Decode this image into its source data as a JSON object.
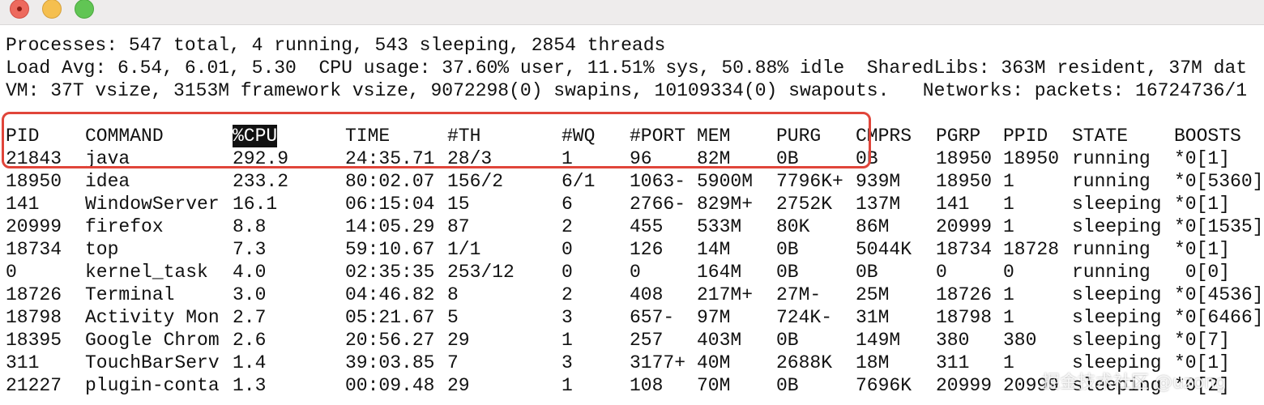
{
  "window": {
    "buttons": {
      "close": "close-button",
      "minimize": "minimize-button",
      "zoom": "zoom-button"
    }
  },
  "summary": [
    "Processes: 547 total, 4 running, 543 sleeping, 2854 threads",
    "Load Avg: 6.54, 6.01, 5.30  CPU usage: 37.60% user, 11.51% sys, 50.88% idle  SharedLibs: 363M resident, 37M dat",
    "VM: 37T vsize, 3153M framework vsize, 9072298(0) swapins, 10109334(0) swapouts.   Networks: packets: 16724736/1"
  ],
  "table": {
    "columns": [
      "PID",
      "COMMAND",
      "%CPU",
      "TIME",
      "#TH",
      "#WQ",
      "#PORT",
      "MEM",
      "PURG",
      "CMPRS",
      "PGRP",
      "PPID",
      "STATE",
      "BOOSTS"
    ],
    "rows": [
      [
        "21843",
        "java",
        "292.9",
        "24:35.71",
        "28/3",
        "1",
        "96",
        "82M",
        "0B",
        "0B",
        "18950",
        "18950",
        "running",
        "*0[1]"
      ],
      [
        "18950",
        "idea",
        "233.2",
        "80:02.07",
        "156/2",
        "6/1",
        "1063-",
        "5900M",
        "7796K+",
        "939M",
        "18950",
        "1",
        "running",
        "*0[5360]"
      ],
      [
        "141",
        "WindowServer",
        "16.1",
        "06:15:04",
        "15",
        "6",
        "2766-",
        "829M+",
        "2752K",
        "137M",
        "141",
        "1",
        "sleeping",
        "*0[1]"
      ],
      [
        "20999",
        "firefox",
        "8.8",
        "14:05.29",
        "87",
        "2",
        "455",
        "533M",
        "80K",
        "86M",
        "20999",
        "1",
        "sleeping",
        "*0[1535]"
      ],
      [
        "18734",
        "top",
        "7.3",
        "59:10.67",
        "1/1",
        "0",
        "126",
        "14M",
        "0B",
        "5044K",
        "18734",
        "18728",
        "running",
        "*0[1]"
      ],
      [
        "0",
        "kernel_task",
        "4.0",
        "02:35:35",
        "253/12",
        "0",
        "0",
        "164M",
        "0B",
        "0B",
        "0",
        "0",
        "running",
        " 0[0]"
      ],
      [
        "18726",
        "Terminal",
        "3.0",
        "04:46.82",
        "8",
        "2",
        "408",
        "217M+",
        "27M-",
        "25M",
        "18726",
        "1",
        "sleeping",
        "*0[4536]"
      ],
      [
        "18798",
        "Activity Mon",
        "2.7",
        "05:21.67",
        "5",
        "3",
        "657-",
        "97M",
        "724K-",
        "31M",
        "18798",
        "1",
        "sleeping",
        "*0[6466]"
      ],
      [
        "18395",
        "Google Chrom",
        "2.6",
        "20:56.27",
        "29",
        "1",
        "257",
        "403M",
        "0B",
        "149M",
        "380",
        "380",
        "sleeping",
        "*0[7]"
      ],
      [
        "311",
        "TouchBarServ",
        "1.4",
        "39:03.85",
        "7",
        "3",
        "3177+",
        "40M",
        "2688K",
        "18M",
        "311",
        "1",
        "sleeping",
        "*0[1]"
      ],
      [
        "21227",
        "plugin-conta",
        "1.3",
        "00:09.48",
        "29",
        "1",
        "108",
        "70M",
        "0B",
        "7696K",
        "20999",
        "20999",
        "sleeping",
        "*0[2]"
      ]
    ]
  },
  "watermark": "掘金技术社区 @uzong",
  "colors": {
    "highlight_box": "#e0453a",
    "header_highlight_bg": "#111111"
  }
}
